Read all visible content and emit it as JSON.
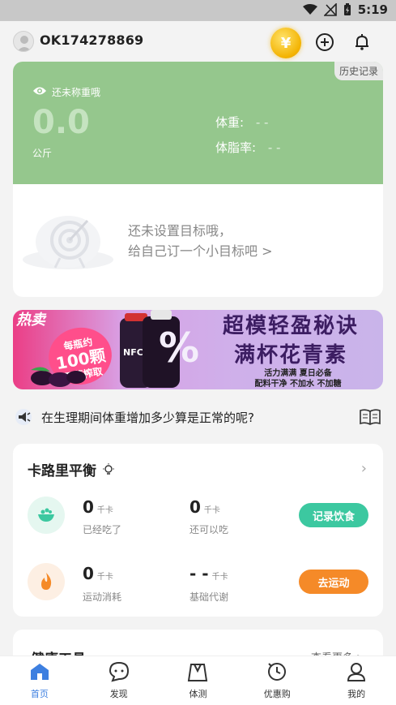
{
  "status_bar": {
    "time": "5:19",
    "icons": [
      "wifi-icon",
      "no-signal-icon",
      "battery-icon"
    ]
  },
  "header": {
    "username": "OK174278869",
    "icons": [
      "coin-icon",
      "add-circle-icon",
      "bell-icon"
    ]
  },
  "weight_card": {
    "history_label": "历史记录",
    "status_text": "还未称重哦",
    "value": "0.0",
    "unit": "公斤",
    "weight_label": "体重:",
    "weight_value": "- -",
    "bodyfat_label": "体脂率:",
    "bodyfat_value": "- -",
    "goal_line1": "还未设置目标哦，",
    "goal_line2": "给自己订一个小目标吧 >",
    "accent_color": "#95c78d"
  },
  "banner": {
    "hot_label": "热卖",
    "badge_line1": "每瓶约",
    "badge_number": "100颗",
    "badge_line2": "桑葚榨取",
    "headline_line1": "超模轻盈秘诀",
    "headline_line2": "满杯花青素",
    "sub_line1": "活力满满  夏日必备",
    "sub_line2": "配料干净  不加水  不加糖",
    "bottle_label": "NFC"
  },
  "article": {
    "title": "在生理期间体重增加多少算是正常的呢?"
  },
  "calorie_card": {
    "title": "卡路里平衡",
    "eaten_value": "0",
    "eaten_unit": "千卡",
    "eaten_label": "已经吃了",
    "remaining_value": "0",
    "remaining_unit": "千卡",
    "remaining_label": "还可以吃",
    "record_button": "记录饮食",
    "burned_value": "0",
    "burned_unit": "千卡",
    "burned_label": "运动消耗",
    "bmr_value": "- -",
    "bmr_unit": "千卡",
    "bmr_label": "基础代谢",
    "exercise_button": "去运动",
    "food_color": "#3cc8a0",
    "exercise_color": "#f58a28"
  },
  "tools_card": {
    "title": "健康工具",
    "more": "查看更多 >"
  },
  "tab_bar": {
    "active_color": "#3d7fe0",
    "items": [
      {
        "label": "首页",
        "icon": "home-icon"
      },
      {
        "label": "发现",
        "icon": "chat-icon"
      },
      {
        "label": "体测",
        "icon": "body-scale-icon"
      },
      {
        "label": "优惠购",
        "icon": "coupon-icon"
      },
      {
        "label": "我的",
        "icon": "user-icon"
      }
    ]
  }
}
